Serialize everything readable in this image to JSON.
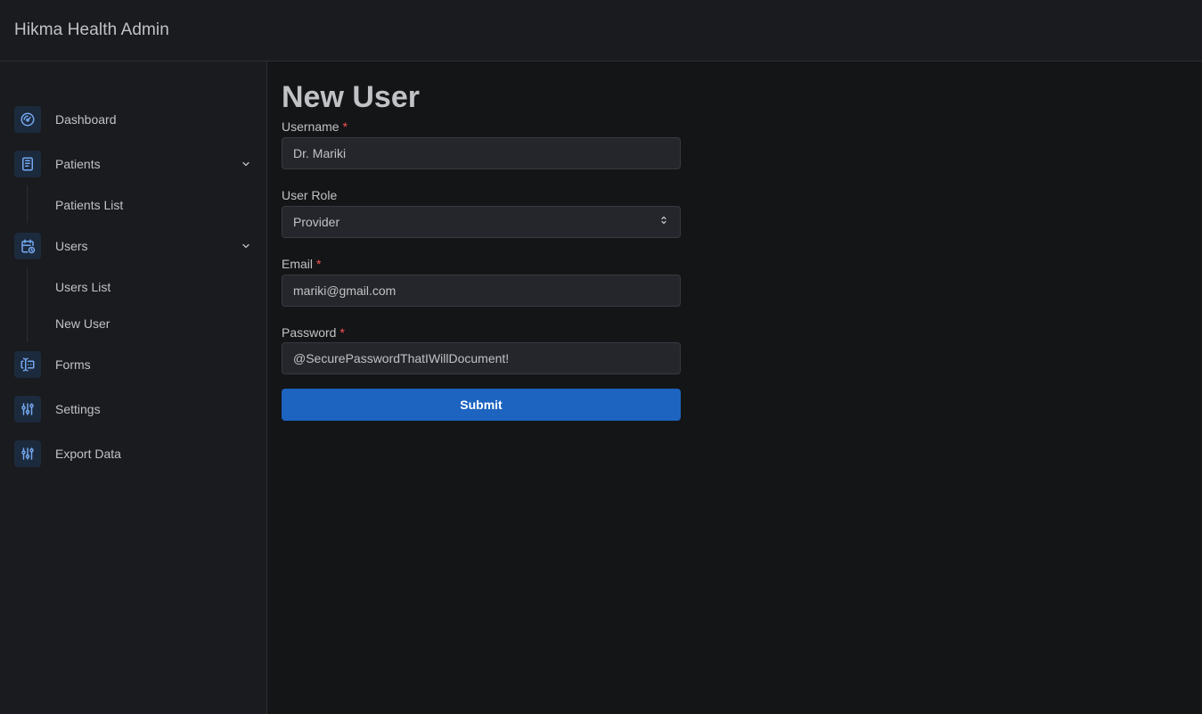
{
  "header": {
    "title": "Hikma Health Admin"
  },
  "sidebar": {
    "items": [
      {
        "label": "Dashboard",
        "icon": "gauge-icon"
      },
      {
        "label": "Patients",
        "icon": "notes-icon",
        "children": [
          "Patients List"
        ]
      },
      {
        "label": "Users",
        "icon": "calendar-stats-icon",
        "children": [
          "Users List",
          "New User"
        ]
      },
      {
        "label": "Forms",
        "icon": "forms-icon"
      },
      {
        "label": "Settings",
        "icon": "adjustments-icon"
      },
      {
        "label": "Export Data",
        "icon": "adjustments-icon"
      }
    ]
  },
  "form": {
    "title": "New User",
    "username": {
      "label": "Username",
      "required_mark": "*",
      "value": "Dr. Mariki"
    },
    "role": {
      "label": "User Role",
      "value": "Provider"
    },
    "email": {
      "label": "Email",
      "required_mark": "*",
      "value": "mariki@gmail.com"
    },
    "password": {
      "label": "Password",
      "required_mark": "*",
      "value": "@SecurePasswordThatIWillDocument!"
    },
    "submit_label": "Submit"
  },
  "colors": {
    "background": "#141517",
    "panel": "#1a1b1e",
    "input_bg": "#25262b",
    "accent": "#1c64c0",
    "icon_accent": "#74a8f0",
    "required": "#fa5252"
  }
}
